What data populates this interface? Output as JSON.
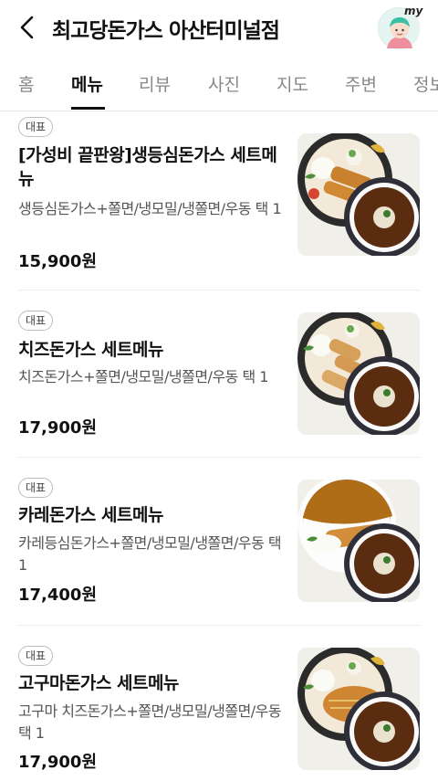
{
  "header": {
    "title": "최고당돈가스 아산터미널점",
    "my_label": "my"
  },
  "tabs": [
    {
      "label": "홈"
    },
    {
      "label": "메뉴"
    },
    {
      "label": "리뷰"
    },
    {
      "label": "사진"
    },
    {
      "label": "지도"
    },
    {
      "label": "주변"
    },
    {
      "label": "정보"
    }
  ],
  "menu": [
    {
      "badge": "대표",
      "name": "[가성비 끝판왕]생등심돈가스 세트메뉴",
      "desc": "생등심돈가스+쫄면/냉모밀/냉쫄면/우동 택 1",
      "price": "15,900원"
    },
    {
      "badge": "대표",
      "name": "치즈돈가스 세트메뉴",
      "desc": "치즈돈가스+쫄면/냉모밀/냉쫄면/우동 택 1",
      "price": "17,900원"
    },
    {
      "badge": "대표",
      "name": "카레돈가스 세트메뉴",
      "desc": "카레등심돈가스+쫄면/냉모밀/냉쫄면/우동 택 1",
      "price": "17,400원"
    },
    {
      "badge": "대표",
      "name": "고구마돈가스 세트메뉴",
      "desc": "고구마 치즈돈가스+쫄면/냉모밀/냉쫄면/우동 택 1",
      "price": "17,900원"
    }
  ]
}
